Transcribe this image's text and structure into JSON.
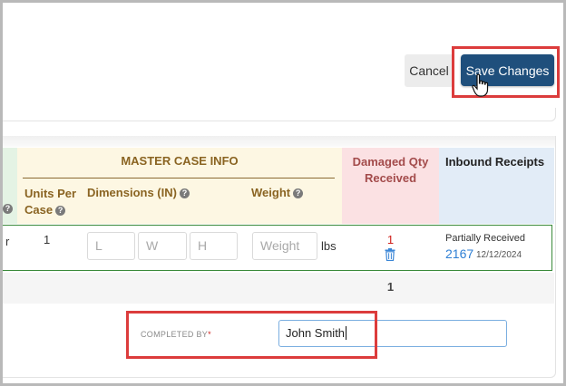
{
  "header": {
    "cancel_label": "Cancel",
    "save_label": "Save Changes"
  },
  "table": {
    "left_fragment_header": "?",
    "master_case_title": "MASTER CASE INFO",
    "columns": {
      "units_per_case": "Units Per Case",
      "dimensions": "Dimensions (IN)",
      "weight": "Weight",
      "damaged_qty": "Damaged Qty Received",
      "inbound_receipts": "Inbound Receipts"
    },
    "row": {
      "left_fragment": "r",
      "units_per_case": "1",
      "dim_l_placeholder": "L",
      "dim_w_placeholder": "W",
      "dim_h_placeholder": "H",
      "weight_placeholder": "Weight",
      "weight_unit": "lbs",
      "damaged_qty": "1",
      "inbound_status": "Partially Received",
      "inbound_number": "2167",
      "inbound_date": "12/12/2024"
    },
    "totals": {
      "damaged_qty": "1"
    }
  },
  "completed_by": {
    "label": "COMPLETED BY",
    "required_marker": "*",
    "value": "John Smith"
  },
  "colors": {
    "save_button": "#1f4f7c",
    "highlight_box": "#dc3c3c",
    "master_case_bg": "#fdf7e3",
    "damaged_bg": "#fbe1e3",
    "inbound_bg": "#e2ecf7",
    "row_border": "#3a8a3a",
    "link": "#2e7fd4"
  },
  "icons": [
    "question-icon",
    "trash-icon",
    "hand-pointer-cursor-icon"
  ]
}
